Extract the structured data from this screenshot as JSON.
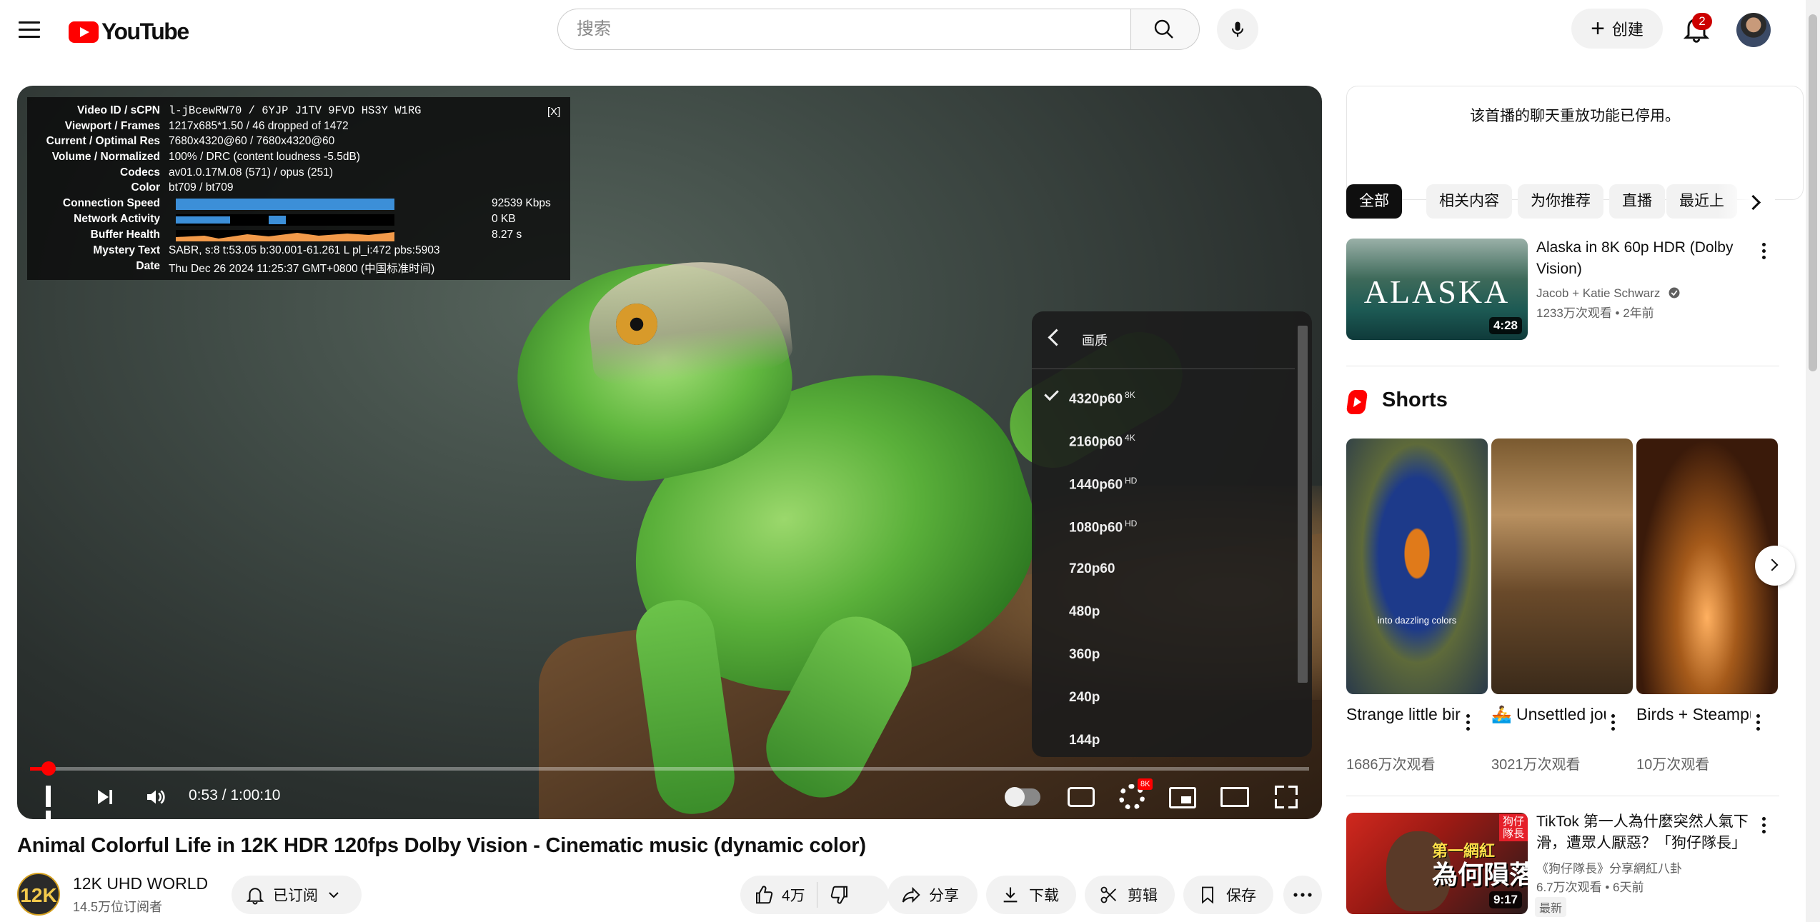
{
  "header": {
    "logo_text": "YouTube",
    "search_placeholder": "搜索",
    "create_label": "创建",
    "notification_count": "2"
  },
  "player": {
    "stats": {
      "close_label": "[X]",
      "rows": [
        {
          "key": "Video ID / sCPN",
          "value": "l-jBcewRW70 / 6YJP J1TV 9FVD HS3Y W1RG"
        },
        {
          "key": "Viewport / Frames",
          "value": "1217x685*1.50 / 46 dropped of 1472"
        },
        {
          "key": "Current / Optimal Res",
          "value": "7680x4320@60 / 7680x4320@60"
        },
        {
          "key": "Volume / Normalized",
          "value": "100% / DRC (content loudness -5.5dB)"
        },
        {
          "key": "Codecs",
          "value": "av01.0.17M.08 (571) / opus (251)"
        },
        {
          "key": "Color",
          "value": "bt709 / bt709"
        },
        {
          "key": "Connection Speed",
          "value": "92539 Kbps"
        },
        {
          "key": "Network Activity",
          "value": "0 KB"
        },
        {
          "key": "Buffer Health",
          "value": "8.27 s"
        },
        {
          "key": "Mystery Text",
          "value": "SABR, s:8 t:53.05 b:30.001-61.261 L pl_i:472 pbs:5903"
        },
        {
          "key": "Date",
          "value": "Thu Dec 26 2024 11:25:37 GMT+0800 (中国标准时间)"
        }
      ]
    },
    "quality_menu": {
      "title": "画质",
      "options": [
        {
          "label": "4320p60",
          "badge": "8K",
          "selected": true
        },
        {
          "label": "2160p60",
          "badge": "4K",
          "selected": false
        },
        {
          "label": "1440p60",
          "badge": "HD",
          "selected": false
        },
        {
          "label": "1080p60",
          "badge": "HD",
          "selected": false
        },
        {
          "label": "720p60",
          "badge": "",
          "selected": false
        },
        {
          "label": "480p",
          "badge": "",
          "selected": false
        },
        {
          "label": "360p",
          "badge": "",
          "selected": false
        },
        {
          "label": "240p",
          "badge": "",
          "selected": false
        },
        {
          "label": "144p",
          "badge": "",
          "selected": false
        }
      ]
    },
    "time_display": "0:53 / 1:00:10",
    "progress_fraction": 0.0147,
    "settings_badge": "8K"
  },
  "video": {
    "title": "Animal Colorful Life in 12K HDR 120fps Dolby Vision - Cinematic music (dynamic color)",
    "channel_avatar_text": "12K",
    "channel_name": "12K UHD WORLD",
    "subscribers": "14.5万位订阅者",
    "subscribed_label": "已订阅",
    "like_count": "4万",
    "share_label": "分享",
    "download_label": "下载",
    "clip_label": "剪辑",
    "save_label": "保存"
  },
  "sidebar": {
    "chat_notice": "该首播的聊天重放功能已停用。",
    "chips": [
      "全部",
      "相关内容",
      "为你推荐",
      "直播",
      "最近上"
    ],
    "recommendations": [
      {
        "thumb_text": "ALASKA",
        "duration": "4:28",
        "title_line1": "Alaska in 8K 60p HDR (Dolby",
        "title_line2": "Vision)",
        "channel": "Jacob + Katie Schwarz",
        "meta": "1233万次观看 • 2年前"
      }
    ],
    "shorts_heading": "Shorts",
    "shorts": [
      {
        "caption": "into dazzling colors",
        "title": "Strange little bird ...",
        "views": "1686万次观看"
      },
      {
        "caption": "",
        "title": "🚣 Unsettled journey of ...",
        "views": "3021万次观看"
      },
      {
        "caption": "",
        "title": "Birds + Steampunk...",
        "views": "10万次观看"
      }
    ],
    "tiktok_video": {
      "tag": "狗仔隊長",
      "thumb_top": "第一網紅",
      "thumb_text": "為何隕落",
      "duration": "9:17",
      "title_line1": "TikTok 第一人為什麼突然人氣下",
      "title_line2": "滑，遭眾人厭惡？「狗仔隊長」",
      "channel": "《狗仔隊長》分享網紅八卦",
      "meta": "6.7万次观看 • 6天前",
      "badge": "最新"
    }
  },
  "colors": {
    "accent_red": "#ff0000",
    "chip_active": "#0f0f0f",
    "stats_bar": "#3c8fd8"
  }
}
